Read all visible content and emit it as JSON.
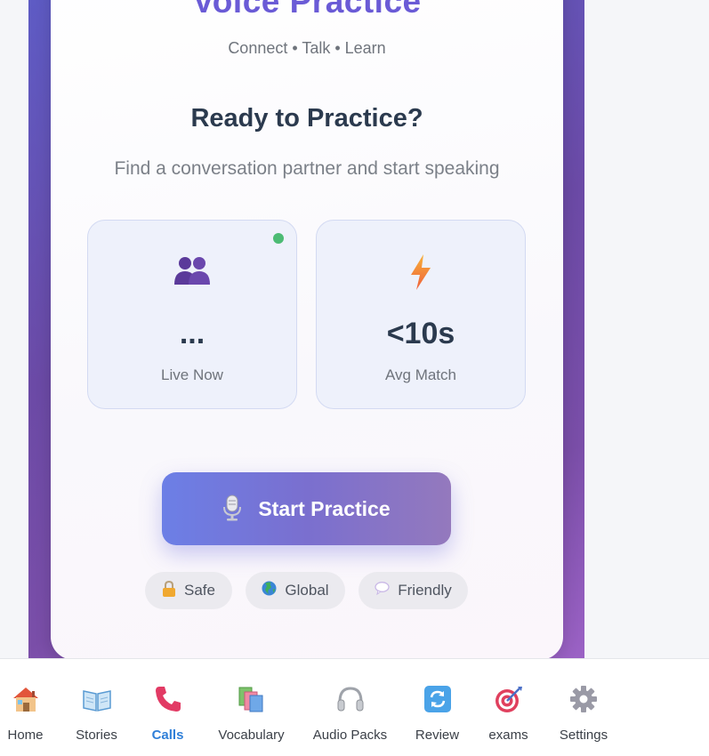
{
  "app": {
    "title": "Voice Practice",
    "tagline": "Connect • Talk • Learn"
  },
  "hero": {
    "heading": "Ready to Practice?",
    "subheading": "Find a conversation partner and start speaking"
  },
  "stats": {
    "live": {
      "value": "...",
      "label": "Live Now",
      "icon": "people-icon"
    },
    "match": {
      "value": "<10s",
      "label": "Avg Match",
      "icon": "lightning-icon"
    }
  },
  "start_button": {
    "label": "Start Practice",
    "icon": "microphone-icon"
  },
  "chips": [
    {
      "label": "Safe",
      "icon": "lock-icon"
    },
    {
      "label": "Global",
      "icon": "globe-icon"
    },
    {
      "label": "Friendly",
      "icon": "speech-bubble-icon"
    }
  ],
  "nav": [
    {
      "label": "Home",
      "icon": "house-icon"
    },
    {
      "label": "Stories",
      "icon": "open-book-icon"
    },
    {
      "label": "Calls",
      "icon": "phone-icon",
      "active": true
    },
    {
      "label": "Vocabulary",
      "icon": "books-icon"
    },
    {
      "label": "Audio Packs",
      "icon": "headphones-icon"
    },
    {
      "label": "Review",
      "icon": "refresh-icon"
    },
    {
      "label": "exams",
      "icon": "target-icon"
    },
    {
      "label": "Settings",
      "icon": "gear-icon"
    }
  ],
  "colors": {
    "accent": "#6a5bd6",
    "active_nav": "#2f7fd8",
    "live_dot": "#4cbb74"
  }
}
